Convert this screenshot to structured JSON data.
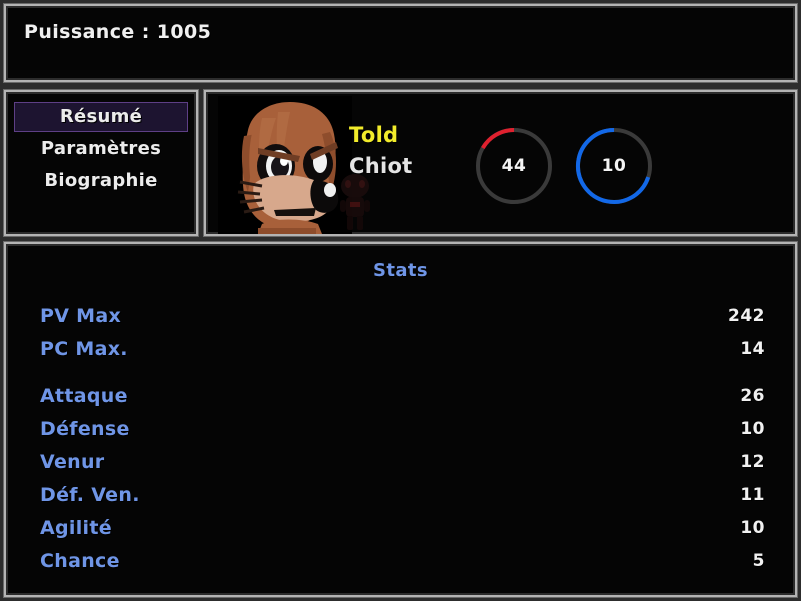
{
  "header": {
    "power_label": "Puissance",
    "power_value": "1005",
    "power_text": "Puissance : 1005"
  },
  "tabs": {
    "items": [
      {
        "label": "Résumé",
        "selected": true
      },
      {
        "label": "Paramètres",
        "selected": false
      },
      {
        "label": "Biographie",
        "selected": false
      }
    ]
  },
  "character": {
    "name": "Told",
    "species": "Chiot",
    "avatar_icon": "puppy-portrait-icon",
    "shadow_icon": "dark-creature-sprite-icon",
    "name_color": "#f2ec2b",
    "species_color": "#e4e4e4"
  },
  "gauges": [
    {
      "id": "hp",
      "name": "hp-gauge",
      "value": "44",
      "fraction": 0.18,
      "color": "#e0202e",
      "track_color": "#3a3a3a"
    },
    {
      "id": "pc",
      "name": "pc-gauge",
      "value": "10",
      "fraction": 0.71,
      "color": "#1268e8",
      "track_color": "#3a3a3a"
    }
  ],
  "stats": {
    "title": "Stats",
    "label_color": "#6f95e6",
    "value_color": "#f1f1f1",
    "rows": [
      {
        "label": "PV Max",
        "value": "242",
        "gap_before": false
      },
      {
        "label": "PC Max.",
        "value": "14",
        "gap_before": false
      },
      {
        "label": "Attaque",
        "value": "26",
        "gap_before": true
      },
      {
        "label": "Défense",
        "value": "10",
        "gap_before": false
      },
      {
        "label": "Venur",
        "value": "12",
        "gap_before": false
      },
      {
        "label": "Déf. Ven.",
        "value": "11",
        "gap_before": false
      },
      {
        "label": "Agilité",
        "value": "10",
        "gap_before": false
      },
      {
        "label": "Chance",
        "value": "5",
        "gap_before": false
      }
    ]
  },
  "theme": {
    "frame_border": "#b4b4b4",
    "panel_background": "#050505",
    "selected_tab_background": "#1d1430",
    "selected_tab_border": "#5e3f86"
  }
}
